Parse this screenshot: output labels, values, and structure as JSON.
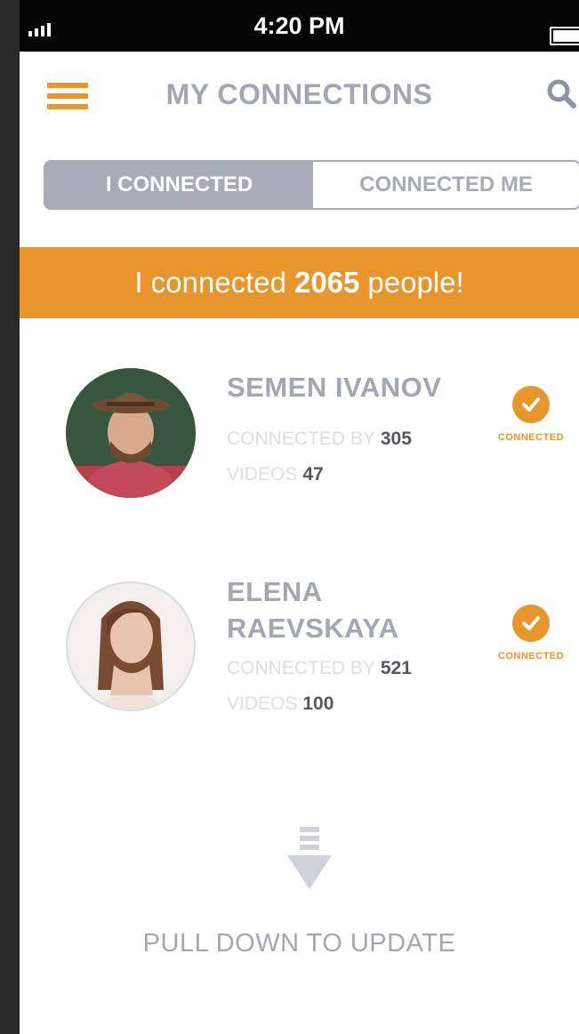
{
  "status_bar": {
    "time": "4:20 PM"
  },
  "header": {
    "title": "MY CONNECTIONS"
  },
  "tabs": [
    {
      "label": "I CONNECTED",
      "active": true
    },
    {
      "label": "CONNECTED ME",
      "active": false
    }
  ],
  "banner": {
    "prefix": "I connected",
    "count": "2065",
    "suffix": "people!"
  },
  "stats_labels": {
    "connected_by": "CONNECTED BY",
    "videos": "VIDEOS"
  },
  "contacts": [
    {
      "name_line1": "SEMEN IVANOV",
      "name_line2": "",
      "connected_by": "305",
      "videos": "47",
      "status": "CONNECTED"
    },
    {
      "name_line1": "ELENA",
      "name_line2": "RAEVSKAYA",
      "connected_by": "521",
      "videos": "100",
      "status": "CONNECTED"
    }
  ],
  "footer": {
    "pull_text": "PULL DOWN TO UPDATE"
  },
  "colors": {
    "accent": "#e8962c",
    "muted": "#a3a7b3",
    "status_bar": "#050505"
  }
}
